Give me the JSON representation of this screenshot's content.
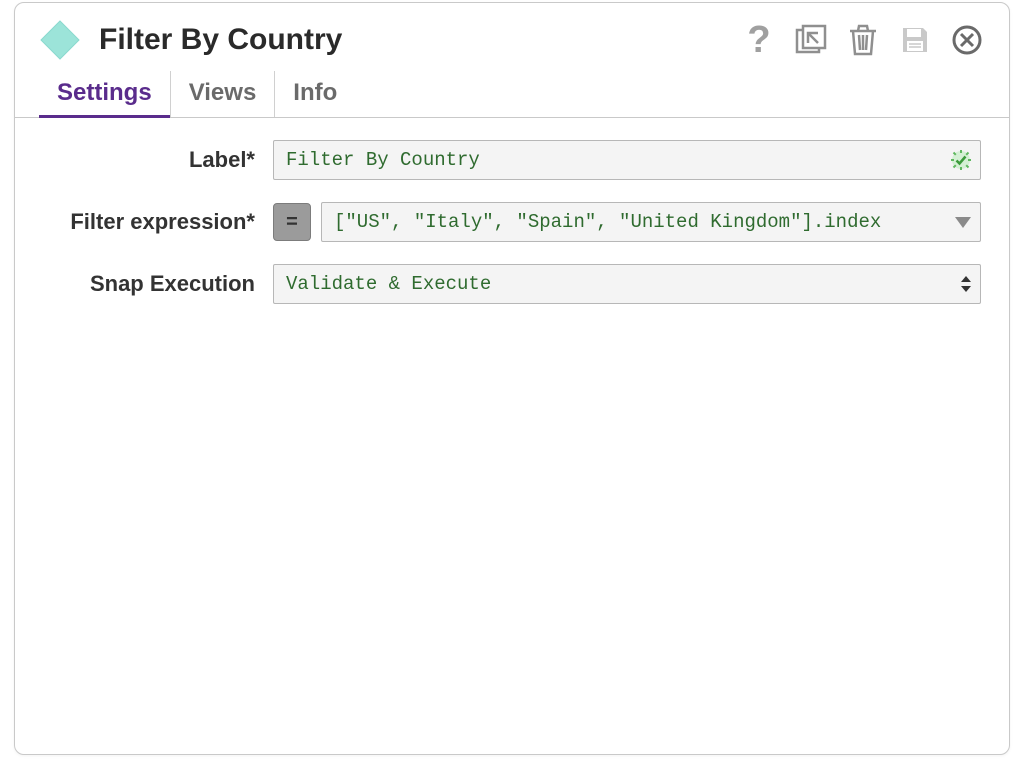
{
  "header": {
    "title": "Filter By Country"
  },
  "tabs": {
    "settings": "Settings",
    "views": "Views",
    "info": "Info"
  },
  "form": {
    "label_field": {
      "label": "Label*",
      "value": "Filter By Country"
    },
    "filter_expression": {
      "label": "Filter expression*",
      "eq_symbol": "=",
      "value": "[\"US\", \"Italy\", \"Spain\", \"United Kingdom\"].index"
    },
    "snap_execution": {
      "label": "Snap Execution",
      "value": "Validate & Execute"
    }
  }
}
